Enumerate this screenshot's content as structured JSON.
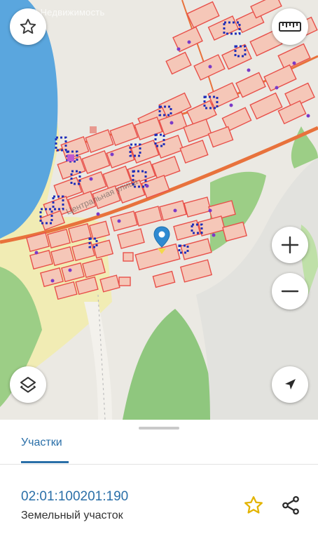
{
  "map": {
    "watermark": "© Недвижимость",
    "street_label": "Центральная улица",
    "colors": {
      "water": "#5aa6de",
      "forest": "#8fc77e",
      "sand": "#f1ecb4",
      "parcel_fill": "#f5c7b8",
      "parcel_border": "#e8504a",
      "road": "#e8723c",
      "marker": "#2f8ad1"
    },
    "controls": {
      "favorite_icon": "star-outline-icon",
      "ruler_icon": "ruler-icon",
      "zoom_in_icon": "plus-icon",
      "zoom_out_icon": "minus-icon",
      "layers_icon": "layers-icon",
      "locate_icon": "navigation-arrow-icon"
    }
  },
  "sheet": {
    "tab_label": "Участки",
    "parcel": {
      "cadastral_number": "02:01:100201:190",
      "type": "Земельный участок"
    },
    "actions": {
      "favorite_icon": "star-outline-icon",
      "share_icon": "share-icon"
    },
    "accent_color": "#2a6fa8",
    "star_color": "#e3b400"
  }
}
